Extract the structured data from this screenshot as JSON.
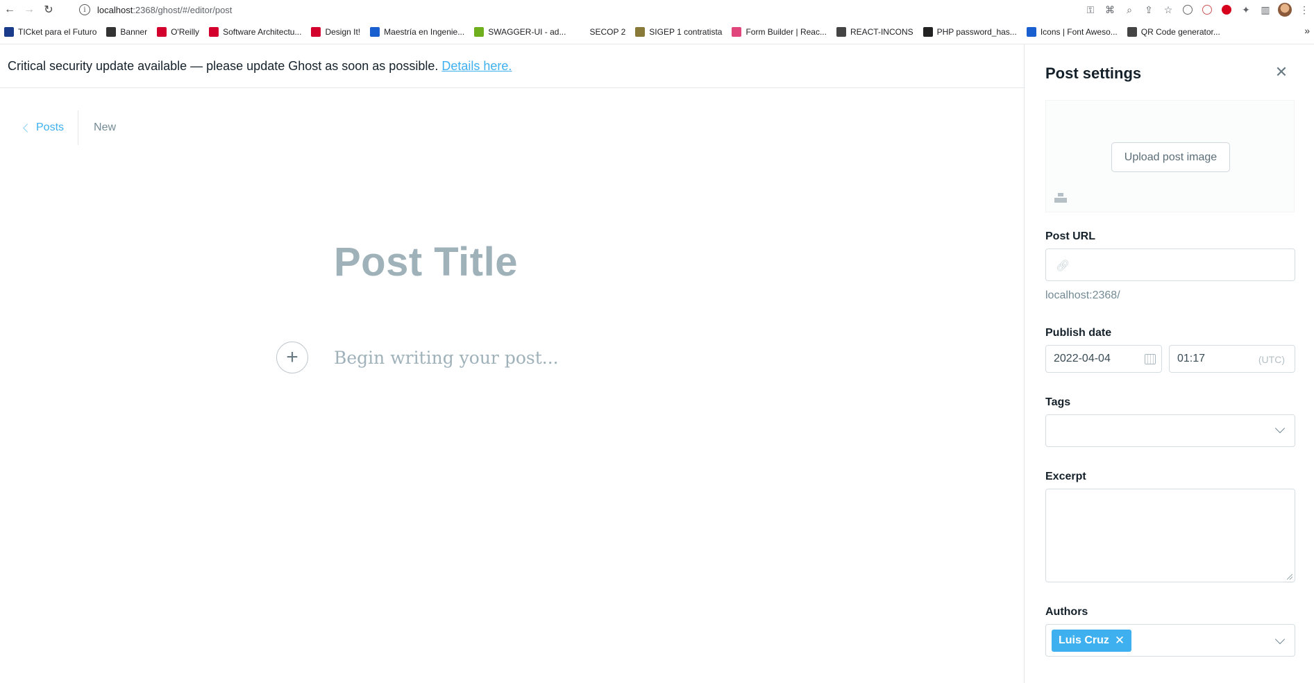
{
  "browser": {
    "url_host": "localhost",
    "url_path": ":2368/ghost/#/editor/post",
    "bookmarks": [
      {
        "label": "TICket para el Futuro",
        "color": "#1a3a8a"
      },
      {
        "label": "Banner",
        "color": "#333333"
      },
      {
        "label": "O'Reilly",
        "color": "#d3002d"
      },
      {
        "label": "Software Architectu...",
        "color": "#d3002d"
      },
      {
        "label": "Design It!",
        "color": "#d3002d"
      },
      {
        "label": "Maestría en Ingenie...",
        "color": "#1a5fd0"
      },
      {
        "label": "SWAGGER-UI - ad...",
        "color": "#6fae1d"
      },
      {
        "label": "SECOP 2",
        "color": "#ffffff"
      },
      {
        "label": "SIGEP 1 contratista",
        "color": "#8a7a3a"
      },
      {
        "label": "Form Builder | Reac...",
        "color": "#e0457b"
      },
      {
        "label": "REACT-INCONS",
        "color": "#444444"
      },
      {
        "label": "PHP password_has...",
        "color": "#222222"
      },
      {
        "label": "Icons | Font Aweso...",
        "color": "#1a5fd0"
      },
      {
        "label": "QR Code generator...",
        "color": "#444444"
      }
    ],
    "more": "»"
  },
  "alert": {
    "message": "Critical security update available — please update Ghost as soon as possible.",
    "link": "Details here."
  },
  "editor": {
    "back_label": "Posts",
    "status": "New",
    "title_placeholder": "Post Title",
    "body_placeholder": "Begin writing your post..."
  },
  "settings": {
    "title": "Post settings",
    "upload_label": "Upload post image",
    "url_label": "Post URL",
    "url_value": "",
    "url_preview": "localhost:2368/",
    "publish_label": "Publish date",
    "date_value": "2022-04-04",
    "time_value": "01:17",
    "timezone": "(UTC)",
    "tags_label": "Tags",
    "excerpt_label": "Excerpt",
    "authors_label": "Authors",
    "author_name": "Luis Cruz"
  },
  "colors": {
    "accent": "#3eb0ef",
    "placeholder": "#9fb1b9"
  }
}
